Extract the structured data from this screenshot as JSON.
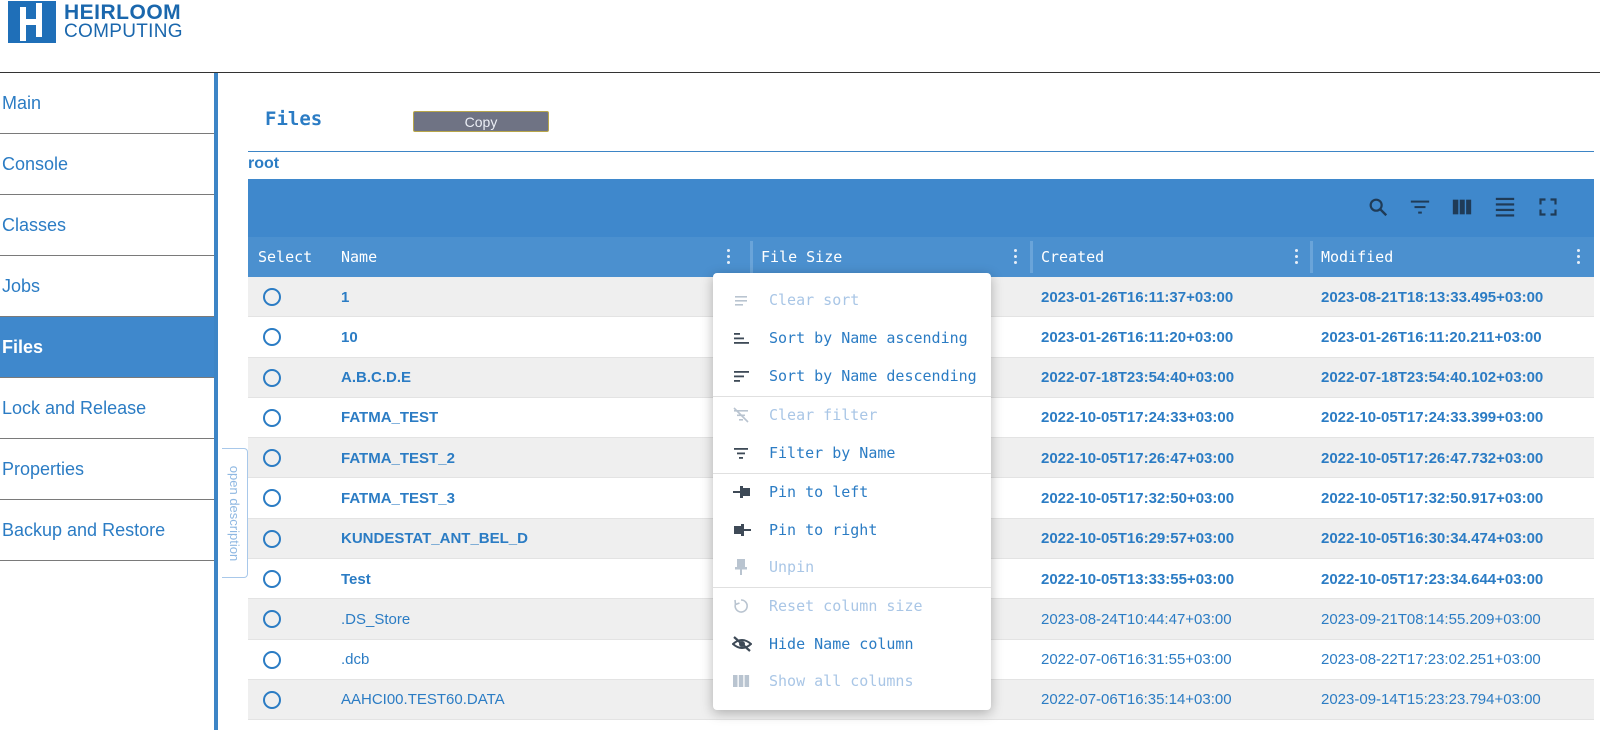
{
  "logo": {
    "line1": "HEIRLOOM",
    "line2": "COMPUTING"
  },
  "sidebar": {
    "items": [
      {
        "label": "Main"
      },
      {
        "label": "Console"
      },
      {
        "label": "Classes"
      },
      {
        "label": "Jobs"
      },
      {
        "label": "Files"
      },
      {
        "label": "Lock and Release"
      },
      {
        "label": "Properties"
      },
      {
        "label": "Backup and Restore"
      }
    ],
    "active": "Files"
  },
  "open_description": "open description",
  "main": {
    "title": "Files",
    "copy_label": "Copy",
    "breadcrumb": "root"
  },
  "toolbar_icons": [
    "search-icon",
    "filter-icon",
    "columns-icon",
    "density-icon",
    "fullscreen-icon"
  ],
  "table": {
    "headers": [
      "Select",
      "Name",
      "File Size",
      "Created",
      "Modified"
    ],
    "rows": [
      {
        "name": "1",
        "created": "2023-01-26T16:11:37+03:00",
        "modified": "2023-08-21T18:13:33.495+03:00",
        "folder": true
      },
      {
        "name": "10",
        "created": "2023-01-26T16:11:20+03:00",
        "modified": "2023-01-26T16:11:20.211+03:00",
        "folder": true
      },
      {
        "name": "A.B.C.D.E",
        "created": "2022-07-18T23:54:40+03:00",
        "modified": "2022-07-18T23:54:40.102+03:00",
        "folder": true
      },
      {
        "name": "FATMA_TEST",
        "created": "2022-10-05T17:24:33+03:00",
        "modified": "2022-10-05T17:24:33.399+03:00",
        "folder": true
      },
      {
        "name": "FATMA_TEST_2",
        "created": "2022-10-05T17:26:47+03:00",
        "modified": "2022-10-05T17:26:47.732+03:00",
        "folder": true
      },
      {
        "name": "FATMA_TEST_3",
        "created": "2022-10-05T17:32:50+03:00",
        "modified": "2022-10-05T17:32:50.917+03:00",
        "folder": true
      },
      {
        "name": "KUNDESTAT_ANT_BEL_D",
        "created": "2022-10-05T16:29:57+03:00",
        "modified": "2022-10-05T16:30:34.474+03:00",
        "folder": true
      },
      {
        "name": "Test",
        "created": "2022-10-05T13:33:55+03:00",
        "modified": "2022-10-05T17:23:34.644+03:00",
        "folder": true
      },
      {
        "name": ".DS_Store",
        "created": "2023-08-24T10:44:47+03:00",
        "modified": "2023-09-21T08:14:55.209+03:00",
        "folder": false
      },
      {
        "name": ".dcb",
        "created": "2022-07-06T16:31:55+03:00",
        "modified": "2023-08-22T17:23:02.251+03:00",
        "folder": false
      },
      {
        "name": "AAHCI00.TEST60.DATA",
        "created": "2022-07-06T16:35:14+03:00",
        "modified": "2023-09-14T15:23:23.794+03:00",
        "folder": false
      }
    ]
  },
  "column_menu": {
    "items": [
      {
        "label": "Clear sort",
        "icon": "clear-sort-icon",
        "disabled": true
      },
      {
        "label": "Sort by Name ascending",
        "icon": "sort-ascending-icon",
        "disabled": false
      },
      {
        "label": "Sort by Name descending",
        "icon": "sort-descending-icon",
        "disabled": false
      },
      {
        "label": "Clear filter",
        "icon": "clear-filter-icon",
        "disabled": true
      },
      {
        "label": "Filter by Name",
        "icon": "filter-icon",
        "disabled": false
      },
      {
        "label": "Pin to left",
        "icon": "pin-left-icon",
        "disabled": false
      },
      {
        "label": "Pin to right",
        "icon": "pin-right-icon",
        "disabled": false
      },
      {
        "label": "Unpin",
        "icon": "unpin-icon",
        "disabled": true
      },
      {
        "label": "Reset column size",
        "icon": "reset-icon",
        "disabled": true
      },
      {
        "label": "Hide Name column",
        "icon": "hide-icon",
        "disabled": false
      },
      {
        "label": "Show all columns",
        "icon": "show-columns-icon",
        "disabled": true
      }
    ]
  },
  "colors": {
    "accent": "#3f88cc",
    "text": "#2b7cc4",
    "disabled": "#a9c6e6"
  }
}
